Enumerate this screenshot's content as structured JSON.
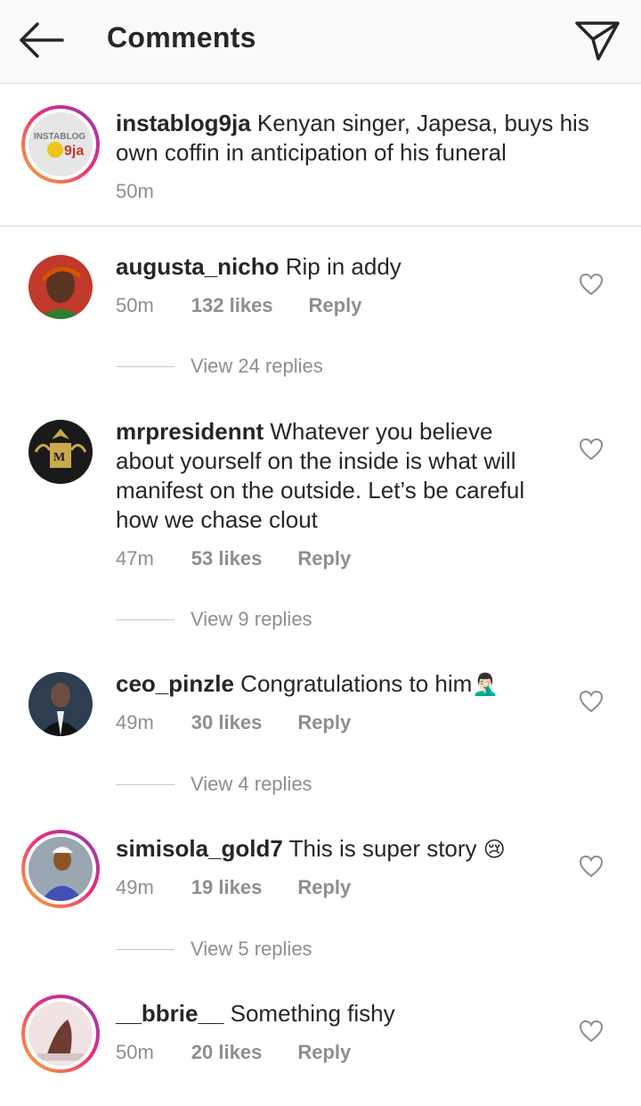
{
  "header": {
    "title": "Comments"
  },
  "caption": {
    "username": "instablog9ja",
    "text": " Kenyan singer, Japesa, buys his own coffin in anticipation of his funeral",
    "time": "50m",
    "avatar_text_top": "INSTABLOG",
    "avatar_text_bottom": "9ja"
  },
  "comments": [
    {
      "username": "augusta_nicho",
      "text": " Rip in addy",
      "time": "50m",
      "likes": "132 likes",
      "reply": "Reply",
      "view_replies": "View 24 replies"
    },
    {
      "username": "mrpresidennt",
      "text": " Whatever you believe about yourself on the inside is what will manifest on the outside. Let’s be careful how we chase clout",
      "time": "47m",
      "likes": "53 likes",
      "reply": "Reply",
      "view_replies": "View 9 replies"
    },
    {
      "username": "ceo_pinzle",
      "text": " Congratulations to him",
      "emoji": "🤦🏻‍♂️",
      "time": "49m",
      "likes": "30 likes",
      "reply": "Reply",
      "view_replies": "View 4 replies"
    },
    {
      "username": "simisola_gold7",
      "text": " This is super story",
      "emoji": "😢",
      "time": "49m",
      "likes": "19 likes",
      "reply": "Reply",
      "view_replies": "View 5 replies"
    },
    {
      "username": "__bbrie__",
      "text": " Something fishy",
      "time": "50m",
      "likes": "20 likes",
      "reply": "Reply"
    }
  ],
  "colors": {
    "meta": "#8e8e8e",
    "text": "#262626",
    "ring_start": "#f9b233",
    "ring_mid": "#ee2a7b",
    "ring_end": "#8a3ab9"
  }
}
